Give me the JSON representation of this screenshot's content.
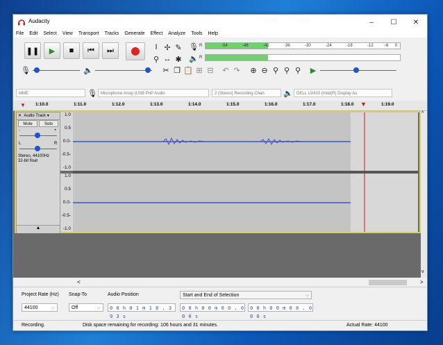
{
  "window": {
    "title": "Audacity",
    "minimize": "–",
    "maximize": "☐",
    "close": "✕"
  },
  "menu": [
    "File",
    "Edit",
    "Select",
    "View",
    "Transport",
    "Tracks",
    "Generate",
    "Effect",
    "Analyze",
    "Tools",
    "Help"
  ],
  "meters": {
    "rec_label": "R",
    "play_label": "R",
    "ticks": [
      "-54",
      "-48",
      "-42",
      "-36",
      "-30",
      "-24",
      "-18",
      "-12",
      "-6",
      "0"
    ],
    "fill_level": 0.32,
    "colors": {
      "fill": "#6fd16f"
    }
  },
  "devices": {
    "host": "MME",
    "input": "Microphone Array (USB PnP Audio",
    "channels": "2 (Stereo) Recording Chan",
    "output": "DELL U2410 (Intel(R) Display Au"
  },
  "ruler": {
    "ticks": [
      "1:10.0",
      "1:11.0",
      "1:12.0",
      "1:13.0",
      "1:14.0",
      "1:15.0",
      "1:16.0",
      "1:17.0",
      "1:18.0",
      "1:19.0"
    ]
  },
  "track": {
    "name": "Audio Track",
    "mute": "Mute",
    "solo": "Solo",
    "gain_minus": "-",
    "gain_plus": "+",
    "pan_l": "L",
    "pan_r": "R",
    "info_line1": "Stereo, 44100Hz",
    "info_line2": "32-bit float",
    "collapse": "▲",
    "scale": [
      "1.0",
      "0.5",
      "0.0-",
      "-0.5-",
      "-1.0"
    ],
    "scale2": [
      "1.0",
      "0.5",
      "0.0-",
      "-0.5-",
      "-1.0"
    ],
    "wave_color": "#3a54c8"
  },
  "scroll": {
    "left": "<",
    "right": ">",
    "up": "^",
    "down": "v"
  },
  "bottom": {
    "project_rate_label": "Project Rate (Hz)",
    "project_rate_value": "44100",
    "snap_label": "Snap-To",
    "snap_value": "Off",
    "audio_position_label": "Audio Position",
    "audio_position_value": "0 0 h 0 1 m 1 8 . 3 9 3 s",
    "selection_label": "Start and End of Selection",
    "selection_start": "0 0 h 0 0 m 0 0 . 0 0 0 s",
    "selection_end": "0 0 h 0 0 m 0 0 . 0 0 0 s"
  },
  "status": {
    "left": "Recording.",
    "center": "Disk space remaining for recording: 106 hours and 31 minutes.",
    "right": "Actual Rate: 44100"
  }
}
